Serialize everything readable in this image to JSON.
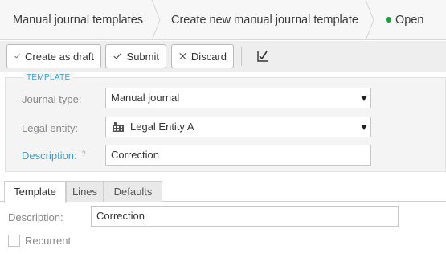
{
  "breadcrumb": {
    "items": [
      "Manual journal templates",
      "Create new manual journal template"
    ],
    "status": "Open",
    "status_color": "#1a9e3a"
  },
  "toolbar": {
    "create_draft_label": "Create as draft",
    "submit_label": "Submit",
    "discard_label": "Discard",
    "extra_icon": "edit-check-icon"
  },
  "template_section": {
    "title": "TEMPLATE",
    "journal_type_label": "Journal type:",
    "journal_type_value": "Manual journal",
    "legal_entity_label": "Legal entity:",
    "legal_entity_value": "Legal Entity A",
    "legal_entity_icon": "building-icon",
    "description_label": "Description:",
    "description_help": "?",
    "description_value": "Correction"
  },
  "tabs": [
    "Template",
    "Lines",
    "Defaults"
  ],
  "active_tab": "Template",
  "tab_content": {
    "description_label": "Description:",
    "description_value": "Correction",
    "recurrent_label": "Recurrent",
    "recurrent_checked": false
  },
  "colors": {
    "accent": "#3a9fd6",
    "status_green": "#1a9e3a"
  }
}
